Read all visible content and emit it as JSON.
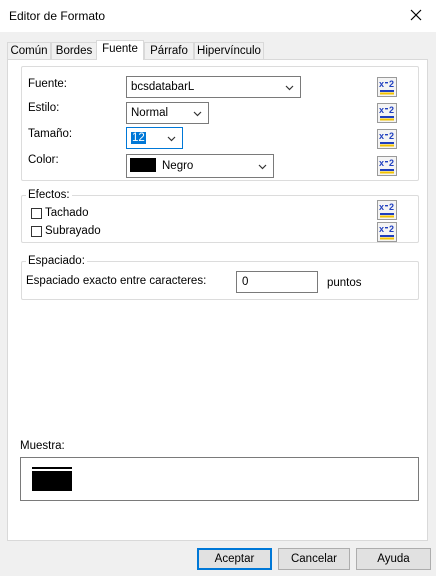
{
  "window": {
    "title": "Editor de Formato"
  },
  "tabs": [
    {
      "label": "Común"
    },
    {
      "label": "Bordes"
    },
    {
      "label": "Fuente"
    },
    {
      "label": "Párrafo"
    },
    {
      "label": "Hipervínculo"
    }
  ],
  "font_group": {
    "font_label": "Fuente:",
    "font_value": "bcsdatabarL",
    "style_label": "Estilo:",
    "style_value": "Normal",
    "size_label": "Tamaño:",
    "size_value": "12",
    "color_label": "Color:",
    "color_value": "Negro",
    "color_swatch": "#000000"
  },
  "effects": {
    "legend": "Efectos:",
    "strikethrough": "Tachado",
    "underline": "Subrayado"
  },
  "spacing": {
    "legend": "Espaciado:",
    "label": "Espaciado exacto entre caracteres:",
    "value": "0",
    "unit": "puntos"
  },
  "preview": {
    "label": "Muestra:"
  },
  "buttons": {
    "ok": "Aceptar",
    "cancel": "Cancelar",
    "help": "Ayuda"
  },
  "icons": {
    "formula_button": "x-2-formula-icon",
    "chevron": "chevron-down-icon",
    "close": "close-icon"
  },
  "colors": {
    "accent": "#0078d7",
    "formula_blue": "#1f3fbf",
    "formula_yellow": "#f2c200"
  }
}
